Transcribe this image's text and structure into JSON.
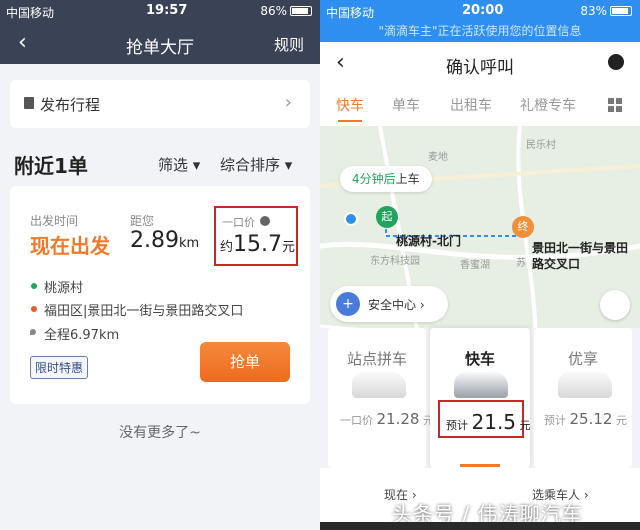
{
  "left": {
    "status": {
      "carrier": "中国移动",
      "time": "19:57",
      "battery": "86%"
    },
    "nav": {
      "back": "‹",
      "title": "抢单大厅",
      "rule": "规则"
    },
    "publish": {
      "label": "发布行程",
      "arrow": "›"
    },
    "list": {
      "nearby": "附近1单",
      "filter": "筛选 ▾",
      "sort": "综合排序 ▾"
    },
    "order": {
      "depart_label": "出发时间",
      "depart_value": "现在出发",
      "distance_label": "距您",
      "distance_value": "2.89",
      "distance_unit": "km",
      "price_label": "一口价",
      "price_prefix": "约",
      "price_value": "15.7",
      "price_unit": "元",
      "from": "桃源村",
      "to": "福田区|景田北一街与景田路交叉口",
      "total": "全程6.97km",
      "tag": "限时特惠",
      "grab_button": "抢单"
    },
    "no_more": "没有更多了~"
  },
  "right": {
    "status": {
      "carrier": "中国移动",
      "time": "20:00",
      "battery": "83%"
    },
    "banner": "\"滴滴车主\"正在活跃使用您的位置信息",
    "nav": {
      "back": "‹",
      "title": "确认呼叫"
    },
    "tabs": [
      "快车",
      "单车",
      "出租车",
      "礼橙专车"
    ],
    "map": {
      "eta_prefix": "4分钟后",
      "eta_suffix": "上车",
      "start_badge": "起",
      "end_badge": "终",
      "start_name": "桃源村-北门",
      "end_name": "景田北一街与景田路交叉口",
      "safety": "安全中心 ›",
      "labels": [
        "麦地",
        "东方科技园",
        "香蜜湖",
        "民乐村",
        "苏"
      ]
    },
    "cars": [
      {
        "name": "站点拼车",
        "price_prefix": "一口价",
        "price": "21.28",
        "unit": "元"
      },
      {
        "name": "快车",
        "price_prefix": "预计",
        "price": "21.5",
        "unit": "元 ›"
      },
      {
        "name": "优享",
        "price_prefix": "预计",
        "price": "25.12",
        "unit": "元"
      }
    ],
    "bottom": {
      "time": "现在 ›",
      "rider": "选乘车人 ›"
    },
    "watermark": "头条号 / 伟涛聊汽车"
  },
  "colors": {
    "accent": "#f07a2a",
    "left_bar": "#3a4256",
    "right_bar": "#2f8ff0",
    "highlight": "#c62828"
  }
}
